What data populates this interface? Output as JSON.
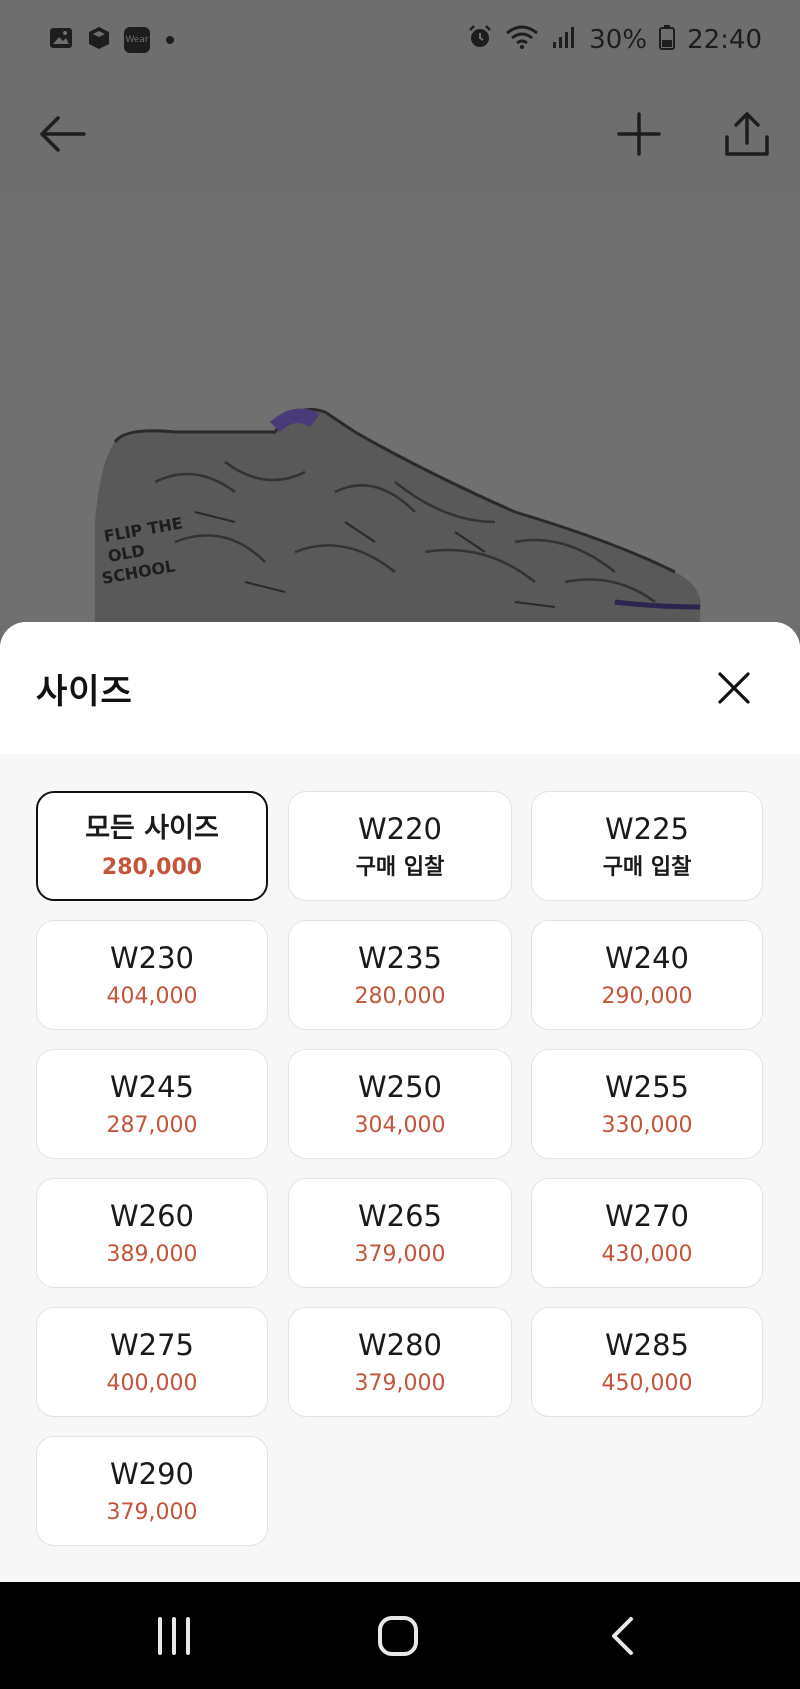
{
  "status_bar": {
    "battery": "30%",
    "time": "22:40",
    "wear_label": "Wear",
    "icons": [
      "gallery-icon",
      "box-icon",
      "wear-icon",
      "dot-icon",
      "alarm-icon",
      "wifi-icon",
      "signal-icon",
      "battery-icon"
    ]
  },
  "top_bar": {
    "icons": [
      "back-arrow-icon",
      "plus-icon",
      "share-icon"
    ]
  },
  "sheet": {
    "title": "사이즈",
    "close_icon": "close-icon",
    "options": [
      {
        "size": "모든 사이즈",
        "price": "280,000",
        "selected": true,
        "bid": false
      },
      {
        "size": "W220",
        "price": "구매 입찰",
        "selected": false,
        "bid": true
      },
      {
        "size": "W225",
        "price": "구매 입찰",
        "selected": false,
        "bid": true
      },
      {
        "size": "W230",
        "price": "404,000",
        "selected": false,
        "bid": false
      },
      {
        "size": "W235",
        "price": "280,000",
        "selected": false,
        "bid": false
      },
      {
        "size": "W240",
        "price": "290,000",
        "selected": false,
        "bid": false
      },
      {
        "size": "W245",
        "price": "287,000",
        "selected": false,
        "bid": false
      },
      {
        "size": "W250",
        "price": "304,000",
        "selected": false,
        "bid": false
      },
      {
        "size": "W255",
        "price": "330,000",
        "selected": false,
        "bid": false
      },
      {
        "size": "W260",
        "price": "389,000",
        "selected": false,
        "bid": false
      },
      {
        "size": "W265",
        "price": "379,000",
        "selected": false,
        "bid": false
      },
      {
        "size": "W270",
        "price": "430,000",
        "selected": false,
        "bid": false
      },
      {
        "size": "W275",
        "price": "400,000",
        "selected": false,
        "bid": false
      },
      {
        "size": "W280",
        "price": "379,000",
        "selected": false,
        "bid": false
      },
      {
        "size": "W285",
        "price": "450,000",
        "selected": false,
        "bid": false
      },
      {
        "size": "W290",
        "price": "379,000",
        "selected": false,
        "bid": false
      }
    ]
  },
  "nav_bar": {
    "icons": [
      "recent-apps-icon",
      "home-icon",
      "back-icon"
    ]
  },
  "colors": {
    "price": "#c4553a",
    "selected_border": "#111111",
    "scrim": "#6e6e6e"
  }
}
